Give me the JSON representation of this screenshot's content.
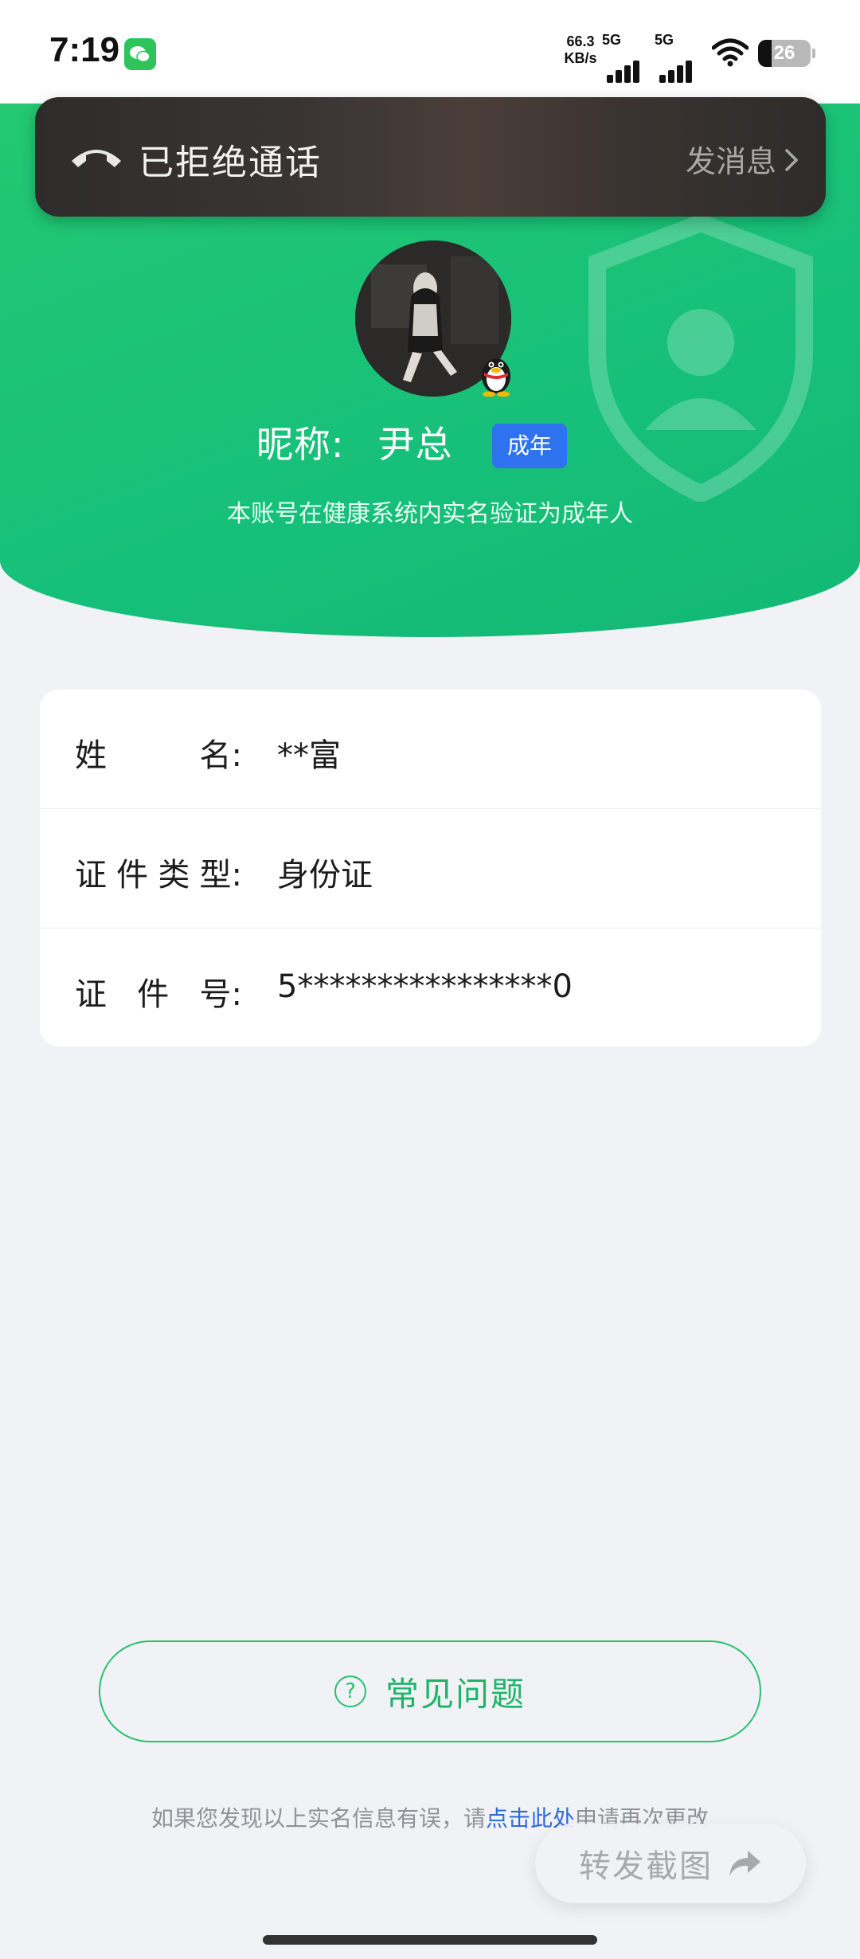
{
  "status_bar": {
    "time": "7:19",
    "net_speed_value": "66.3",
    "net_speed_unit": "KB/s",
    "sim1_label": "5G",
    "sim2_label": "5G",
    "battery_level": "26",
    "notification_icon": "wechat-icon"
  },
  "call_banner": {
    "title": "已拒绝通话",
    "action": "发消息"
  },
  "profile": {
    "nickname_label": "昵称:",
    "nickname": "尹总",
    "age_badge": "成年",
    "verify_note": "本账号在健康系统内实名验证为成年人"
  },
  "info": {
    "rows": [
      {
        "label_chars": [
          "姓",
          "名:"
        ],
        "value": "**富"
      },
      {
        "label_chars": [
          "证",
          "件",
          "类",
          "型:"
        ],
        "value": "身份证"
      },
      {
        "label_chars": [
          "证",
          "件",
          "号:"
        ],
        "value": "5****************0"
      }
    ]
  },
  "faq": {
    "icon": "?",
    "label": "常见问题"
  },
  "footer": {
    "before": "如果您发现以上实名信息有误，请",
    "link": "点击此处",
    "after": "申请再次更改"
  },
  "share": {
    "label": "转发截图"
  },
  "colors": {
    "brand_green": "#17c07a",
    "badge_blue": "#2f72f0",
    "link_blue": "#2f6bdc"
  }
}
